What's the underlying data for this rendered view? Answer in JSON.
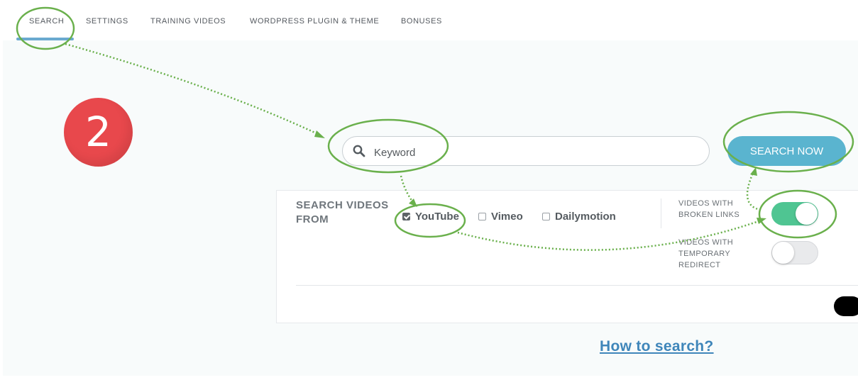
{
  "nav": {
    "tabs": [
      {
        "label": "SEARCH"
      },
      {
        "label": "SETTINGS"
      },
      {
        "label": "TRAINING VIDEOS"
      },
      {
        "label": "WORDPRESS PLUGIN & THEME"
      },
      {
        "label": "BONUSES"
      }
    ],
    "active_tab": "SEARCH"
  },
  "step_badge": "2",
  "search": {
    "placeholder": "Keyword",
    "value": "",
    "button_label": "SEARCH NOW"
  },
  "sources": {
    "label": "SEARCH VIDEOS FROM",
    "options": [
      {
        "label": "YouTube",
        "checked": true
      },
      {
        "label": "Vimeo",
        "checked": false
      },
      {
        "label": "Dailymotion",
        "checked": false
      }
    ]
  },
  "filters": {
    "broken_links": {
      "label": "VIDEOS WITH BROKEN LINKS",
      "enabled": true
    },
    "temporary_redirect": {
      "label": "VIDEOS WITH TEMPORARY REDIRECT",
      "enabled": false
    }
  },
  "help_link": "How to search?",
  "colors": {
    "accent": "#5ab4cf",
    "toggle_on": "#4fc592",
    "badge": "#e8484c",
    "annotation": "#6ab04c",
    "link": "#3f86ba"
  }
}
